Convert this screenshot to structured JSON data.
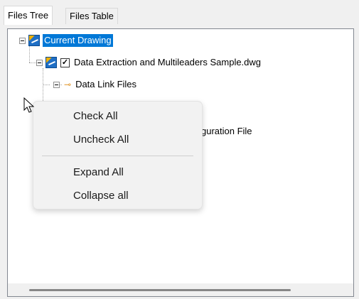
{
  "tabs": [
    {
      "label": "Files Tree",
      "active": true
    },
    {
      "label": "Files Table",
      "active": false
    }
  ],
  "tree": {
    "root": {
      "label": "Current Drawing",
      "selected": true,
      "icon": "dwg-icon"
    },
    "drawing": {
      "label": "Data Extraction and Multileaders Sample.dwg",
      "checked": true,
      "check_glyph": "✓",
      "icon": "dwg-icon"
    },
    "data_link": {
      "label": "Data Link Files",
      "icon": "data-link-icon",
      "icon_glyph": "⊸"
    },
    "partial_item": {
      "label_visible": "guration File"
    }
  },
  "context_menu": {
    "items": [
      {
        "label": "Check All"
      },
      {
        "label": "Uncheck All"
      },
      {
        "label": "Expand All"
      },
      {
        "label": "Collapse all"
      }
    ]
  },
  "colors": {
    "selection": "#0078d7",
    "menu_bg": "#f2f2f2"
  }
}
